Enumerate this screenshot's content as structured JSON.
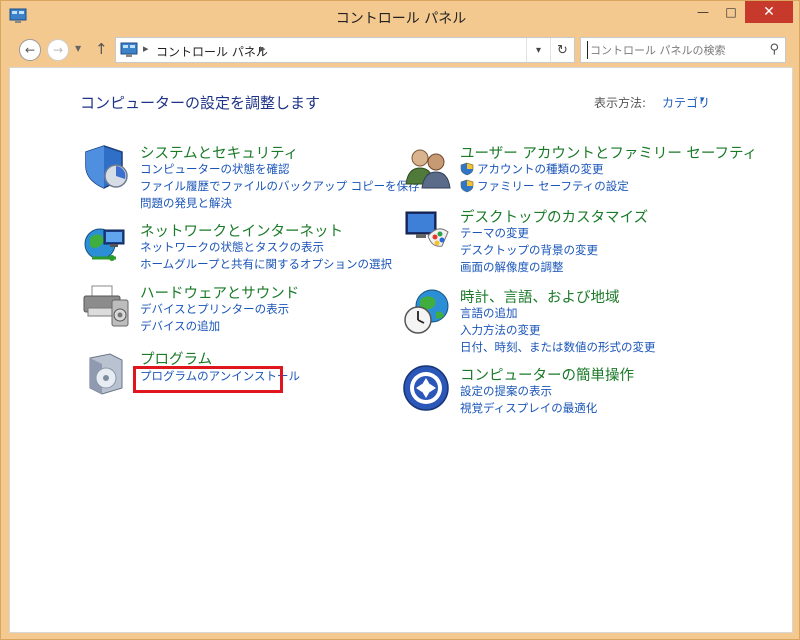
{
  "window": {
    "title": "コントロール パネル"
  },
  "titlebar_buttons": {
    "minimize": "—",
    "maximize": "□",
    "close": "✕"
  },
  "navigation": {
    "back": "←",
    "forward": "→",
    "recent": "▼",
    "up": "↑",
    "address_path": "コントロール パネル",
    "address_sep": "▸",
    "dropdown": "▾",
    "refresh": "↻",
    "search_placeholder": "コントロール パネルの検索",
    "search_icon": "⚲"
  },
  "content": {
    "heading": "コンピューターの設定を調整します",
    "view_by_label": "表示方法:",
    "view_by_value": "カテゴリ",
    "view_by_arrow": "▾"
  },
  "categories": {
    "system": {
      "title": "システムとセキュリティ",
      "links": [
        "コンピューターの状態を確認",
        "ファイル履歴でファイルのバックアップ コピーを保存",
        "問題の発見と解決"
      ]
    },
    "network": {
      "title": "ネットワークとインターネット",
      "links": [
        "ネットワークの状態とタスクの表示",
        "ホームグループと共有に関するオプションの選択"
      ]
    },
    "hardware": {
      "title": "ハードウェアとサウンド",
      "links": [
        "デバイスとプリンターの表示",
        "デバイスの追加"
      ]
    },
    "programs": {
      "title": "プログラム",
      "links": [
        "プログラムのアンインストール"
      ]
    },
    "users": {
      "title": "ユーザー アカウントとファミリー セーフティ",
      "links": [
        "アカウントの種類の変更",
        "ファミリー セーフティの設定"
      ]
    },
    "appearance": {
      "title": "デスクトップのカスタマイズ",
      "links": [
        "テーマの変更",
        "デスクトップの背景の変更",
        "画面の解像度の調整"
      ]
    },
    "clock": {
      "title": "時計、言語、および地域",
      "links": [
        "言語の追加",
        "入力方法の変更",
        "日付、時刻、または数値の形式の変更"
      ]
    },
    "ease": {
      "title": "コンピューターの簡単操作",
      "links": [
        "設定の提案の表示",
        "視覚ディスプレイの最適化"
      ]
    }
  },
  "colors": {
    "title_bar": "#f3c98f",
    "category_title": "#1a7a28",
    "link": "#1a55b8",
    "highlight": "#e0161e"
  }
}
